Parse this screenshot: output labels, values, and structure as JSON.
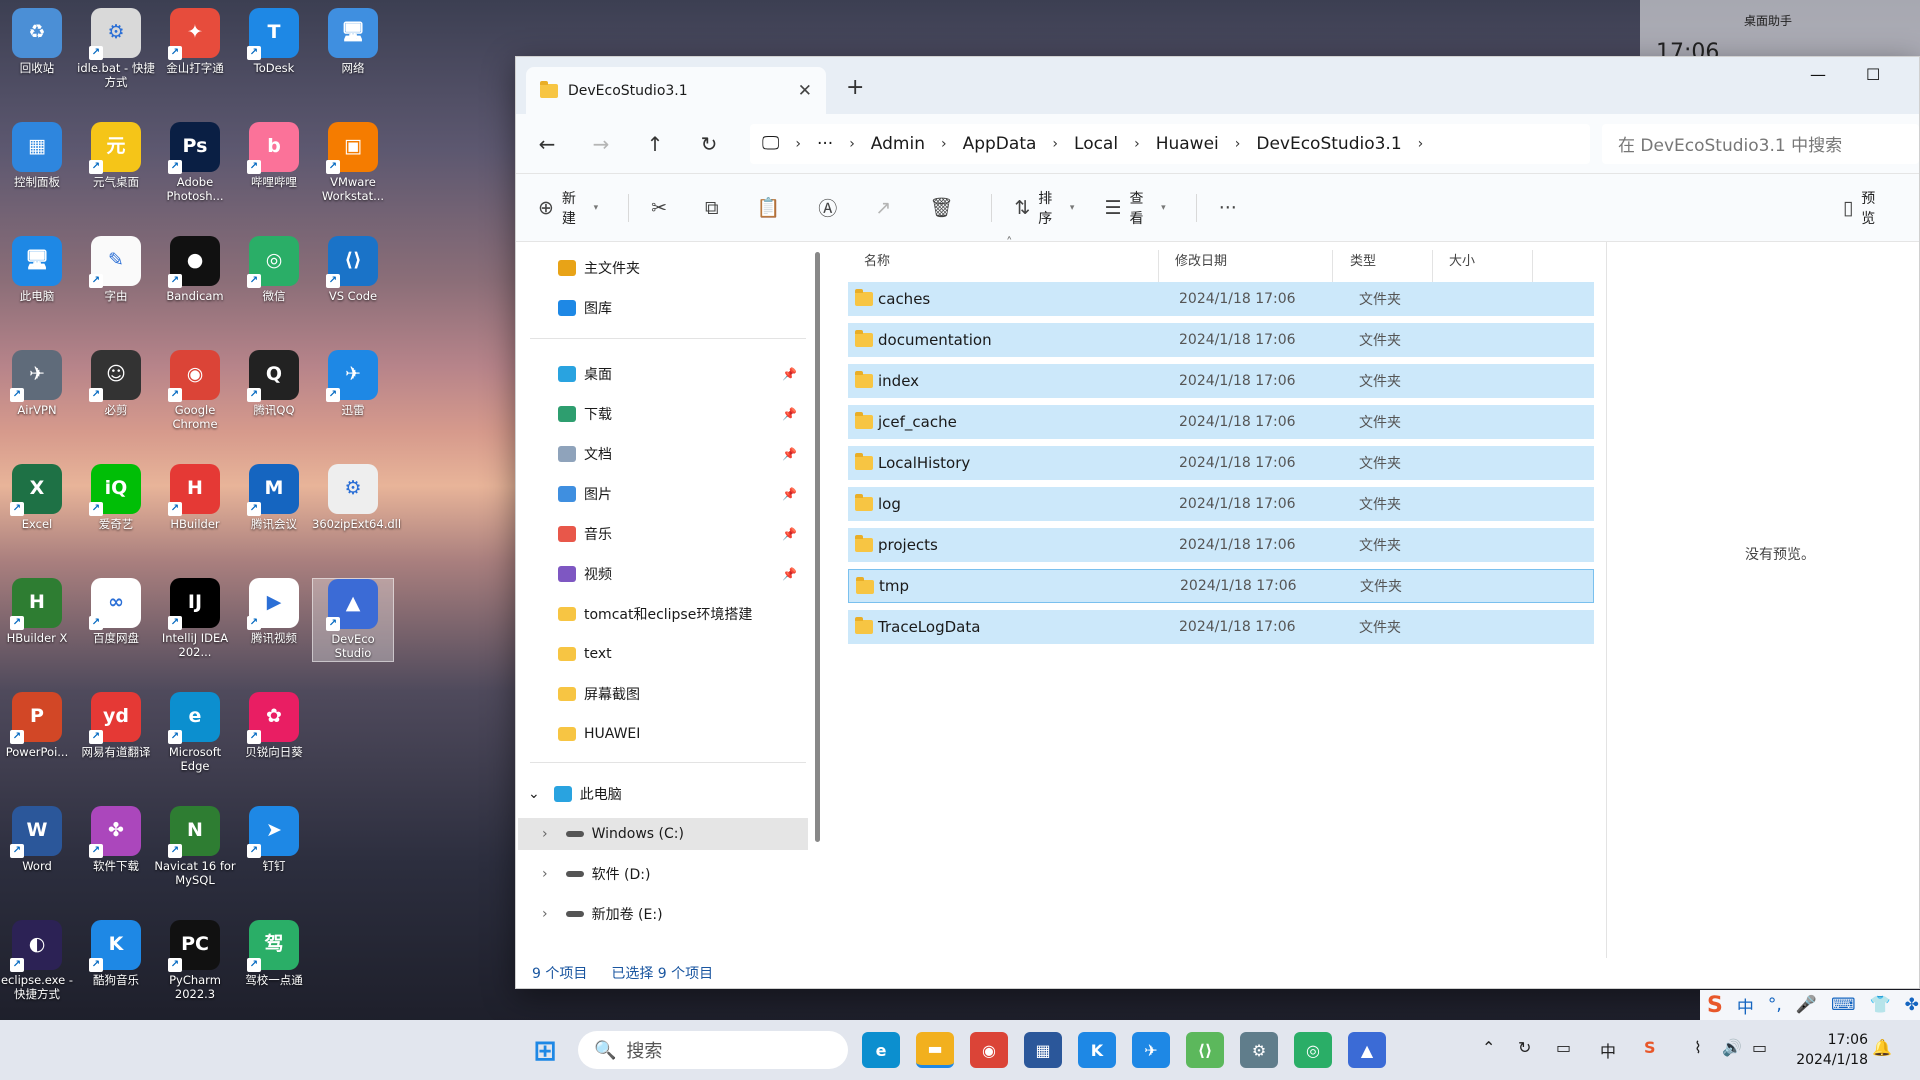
{
  "desktop_icons": [
    {
      "label": "回收站",
      "c": "#4b8fd6",
      "g": "♻",
      "lnk": false
    },
    {
      "label": "idle.bat - 快捷方式",
      "c": "#d9d9d9",
      "g": "⚙"
    },
    {
      "label": "金山打字通",
      "c": "#e74c3c",
      "g": "✦"
    },
    {
      "label": "ToDesk",
      "c": "#1e88e5",
      "g": "T"
    },
    {
      "label": "网络",
      "c": "#3f8fe0",
      "g": "🖥",
      "lnk": false
    },
    {
      "label": "控制面板",
      "c": "#2e86de",
      "g": "▦",
      "lnk": false
    },
    {
      "label": "元气桌面",
      "c": "#f5c518",
      "g": "元"
    },
    {
      "label": "Adobe Photosh...",
      "c": "#0a1f44",
      "g": "Ps"
    },
    {
      "label": "哔哩哔哩",
      "c": "#fb7299",
      "g": "b"
    },
    {
      "label": "VMware Workstat...",
      "c": "#f57c00",
      "g": "▣"
    },
    {
      "label": "此电脑",
      "c": "#1e88e5",
      "g": "🖥",
      "lnk": false
    },
    {
      "label": "字由",
      "c": "#fafafa",
      "g": "✎"
    },
    {
      "label": "Bandicam",
      "c": "#111",
      "g": "●"
    },
    {
      "label": "微信",
      "c": "#2aae67",
      "g": "◎"
    },
    {
      "label": "VS Code",
      "c": "#1a73c8",
      "g": "⟨⟩"
    },
    {
      "label": "AirVPN",
      "c": "#5f6b7a",
      "g": "✈"
    },
    {
      "label": "必剪",
      "c": "#333",
      "g": "☺"
    },
    {
      "label": "Google Chrome",
      "c": "#db4437",
      "g": "◉"
    },
    {
      "label": "腾讯QQ",
      "c": "#222",
      "g": "Q"
    },
    {
      "label": "迅雷",
      "c": "#1e88e5",
      "g": "✈"
    },
    {
      "label": "Excel",
      "c": "#1e7145",
      "g": "X"
    },
    {
      "label": "爱奇艺",
      "c": "#00be06",
      "g": "iQ"
    },
    {
      "label": "HBuilder",
      "c": "#e53935",
      "g": "H"
    },
    {
      "label": "腾讯会议",
      "c": "#1565c0",
      "g": "M"
    },
    {
      "label": "360zipExt64.dll",
      "c": "#eeeeee",
      "g": "⚙",
      "lnk": false
    },
    {
      "label": "HBuilder X",
      "c": "#2e7d32",
      "g": "H"
    },
    {
      "label": "百度网盘",
      "c": "#fff",
      "g": "∞"
    },
    {
      "label": "IntelliJ IDEA 202...",
      "c": "#000",
      "g": "IJ"
    },
    {
      "label": "腾讯视频",
      "c": "#fff",
      "g": "▶"
    },
    {
      "label": "DevEco Studio",
      "c": "#3b6bd6",
      "g": "▲",
      "sel": true
    },
    {
      "label": "PowerPoi...",
      "c": "#d24726",
      "g": "P"
    },
    {
      "label": "网易有道翻译",
      "c": "#e53935",
      "g": "yd"
    },
    {
      "label": "Microsoft Edge",
      "c": "#0c8fcf",
      "g": "e"
    },
    {
      "label": "贝锐向日葵",
      "c": "#e91e63",
      "g": "✿"
    },
    {
      "label": "",
      "c": "",
      "g": ""
    },
    {
      "label": "Word",
      "c": "#2b579a",
      "g": "W"
    },
    {
      "label": "软件下载",
      "c": "#ab47bc",
      "g": "✤"
    },
    {
      "label": "Navicat 16 for MySQL",
      "c": "#2e7d32",
      "g": "N"
    },
    {
      "label": "钉钉",
      "c": "#1e88e5",
      "g": "➤"
    },
    {
      "label": "",
      "c": "",
      "g": ""
    },
    {
      "label": "eclipse.exe - 快捷方式",
      "c": "#2c2255",
      "g": "◐"
    },
    {
      "label": "酷狗音乐",
      "c": "#1e88e5",
      "g": "K"
    },
    {
      "label": "PyCharm 2022.3",
      "c": "#111",
      "g": "PC"
    },
    {
      "label": "驾校一点通",
      "c": "#2aae67",
      "g": "驾"
    }
  ],
  "widget": {
    "title": "桌面助手",
    "time": "17:06"
  },
  "window": {
    "tab_title": "DevEcoStudio3.1",
    "path": [
      "Admin",
      "AppData",
      "Local",
      "Huawei",
      "DevEcoStudio3.1"
    ],
    "search_placeholder": "在 DevEcoStudio3.1 中搜索",
    "toolbar": {
      "new": "新建",
      "sort": "排序",
      "view": "查看",
      "preview": "预览"
    },
    "sidebar": {
      "top": [
        {
          "label": "主文件夹",
          "c": "#e8a317"
        },
        {
          "label": "图库",
          "c": "#1e88e5"
        }
      ],
      "quick": [
        {
          "label": "桌面",
          "c": "#29a3e0",
          "pin": true
        },
        {
          "label": "下载",
          "c": "#2e9e6f",
          "pin": true
        },
        {
          "label": "文档",
          "c": "#8fa3bb",
          "pin": true
        },
        {
          "label": "图片",
          "c": "#3f8fe0",
          "pin": true
        },
        {
          "label": "音乐",
          "c": "#e8574a",
          "pin": true
        },
        {
          "label": "视频",
          "c": "#7e57c2",
          "pin": true
        },
        {
          "label": "tomcat和eclipse环境搭建",
          "c": "#f7c543"
        },
        {
          "label": "text",
          "c": "#f7c543"
        },
        {
          "label": "屏幕截图",
          "c": "#f7c543"
        },
        {
          "label": "HUAWEI",
          "c": "#f7c543"
        }
      ],
      "this_pc": "此电脑",
      "drives": [
        {
          "label": "Windows (C:)",
          "sel": true
        },
        {
          "label": "软件 (D:)"
        },
        {
          "label": "新加卷 (E:)"
        }
      ]
    },
    "columns": [
      "名称",
      "修改日期",
      "类型",
      "大小"
    ],
    "files": [
      {
        "name": "caches",
        "date": "2024/1/18 17:06",
        "type": "文件夹"
      },
      {
        "name": "documentation",
        "date": "2024/1/18 17:06",
        "type": "文件夹"
      },
      {
        "name": "index",
        "date": "2024/1/18 17:06",
        "type": "文件夹"
      },
      {
        "name": "jcef_cache",
        "date": "2024/1/18 17:06",
        "type": "文件夹"
      },
      {
        "name": "LocalHistory",
        "date": "2024/1/18 17:06",
        "type": "文件夹"
      },
      {
        "name": "log",
        "date": "2024/1/18 17:06",
        "type": "文件夹"
      },
      {
        "name": "projects",
        "date": "2024/1/18 17:06",
        "type": "文件夹"
      },
      {
        "name": "tmp",
        "date": "2024/1/18 17:06",
        "type": "文件夹",
        "focus": true
      },
      {
        "name": "TraceLogData",
        "date": "2024/1/18 17:06",
        "type": "文件夹"
      }
    ],
    "preview_text": "没有预览。",
    "status": {
      "count": "9 个项目",
      "selected": "已选择 9 个项目"
    }
  },
  "taskbar": {
    "search": "搜索",
    "apps": [
      {
        "n": "edge",
        "c": "#0c8fcf",
        "g": "e"
      },
      {
        "n": "explorer",
        "c": "#f2b01e",
        "g": "▬",
        "active": true
      },
      {
        "n": "chrome",
        "c": "#db4437",
        "g": "◉"
      },
      {
        "n": "store",
        "c": "#2b579a",
        "g": "▦"
      },
      {
        "n": "kugou",
        "c": "#1e88e5",
        "g": "K"
      },
      {
        "n": "xunlei",
        "c": "#1e88e5",
        "g": "✈"
      },
      {
        "n": "devtool",
        "c": "#5cb85c",
        "g": "⟨⟩"
      },
      {
        "n": "settings",
        "c": "#607d8b",
        "g": "⚙"
      },
      {
        "n": "wechat",
        "c": "#2aae67",
        "g": "◎"
      },
      {
        "n": "deveco",
        "c": "#3b6bd6",
        "g": "▲"
      }
    ],
    "ime": "中",
    "time": "17:06",
    "date": "2024/1/18"
  },
  "ime_bar": [
    "S",
    "中",
    "°,",
    "🎤",
    "⌨",
    "👕",
    "✤"
  ]
}
